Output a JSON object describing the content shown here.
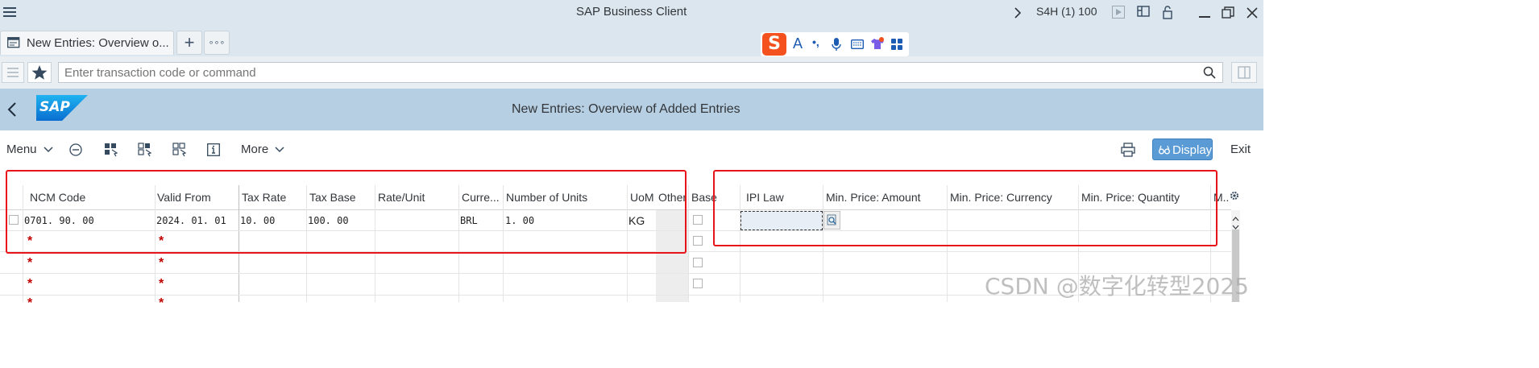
{
  "window": {
    "app_title": "SAP Business Client",
    "system": "S4H (1) 100"
  },
  "tabs": {
    "active_label": "New Entries: Overview o...",
    "add_label": "+",
    "more_label": "∘∘∘"
  },
  "command": {
    "placeholder": "Enter transaction code or command"
  },
  "ime": {
    "letter": "A",
    "punct": "•,"
  },
  "shell": {
    "logo": "SAP",
    "title": "New Entries: Overview of Added Entries"
  },
  "toolbar": {
    "menu_label": "Menu",
    "more_label": "More",
    "display_label": "Display",
    "exit_label": "Exit"
  },
  "table": {
    "columns": [
      "NCM Code",
      "Valid From",
      "Tax Rate",
      "Tax Base",
      "Rate/Unit",
      "Curre...",
      "Number of Units",
      "UoM",
      "Other",
      "Base",
      "IPI Law",
      "Min. Price: Amount",
      "Min. Price: Currency",
      "Min. Price: Quantity",
      "M..."
    ],
    "row1": {
      "ncm_code": "0701. 90. 00",
      "valid_from": "2024. 01. 01",
      "tax_rate": "10. 00",
      "tax_base": "100. 00",
      "currency": "BRL",
      "number_of_units": "1. 00",
      "uom": "KG"
    },
    "required_marker": "*"
  },
  "watermark": "CSDN @数字化转型2025",
  "colors": {
    "title_bar": "#dbe6ef",
    "shell_bar": "#b7cfe2",
    "display_button": "#5a9bd5",
    "annotation_red": "#e8141a",
    "required_red": "#c00000"
  }
}
